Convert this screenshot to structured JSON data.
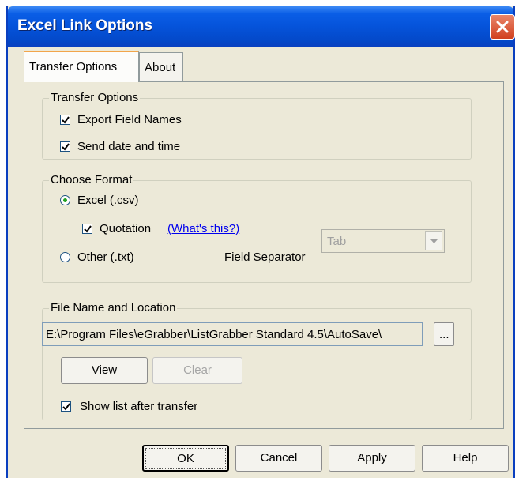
{
  "window": {
    "title": "Excel Link Options"
  },
  "tabs": [
    {
      "label": "Transfer Options",
      "active": true
    },
    {
      "label": "About",
      "active": false
    }
  ],
  "transfer_options": {
    "legend": "Transfer Options",
    "export_field_names": {
      "label": "Export Field Names",
      "checked": true
    },
    "send_date_time": {
      "label": "Send date and time",
      "checked": true
    }
  },
  "choose_format": {
    "legend": "Choose Format",
    "excel": {
      "label": "Excel  (.csv)",
      "selected": true
    },
    "quotation": {
      "label": "Quotation",
      "checked": true
    },
    "whats_this": "(What's this?)",
    "other": {
      "label": "Other  (.txt)",
      "selected": false
    },
    "field_separator": {
      "label": "Field Separator",
      "value": "Tab"
    }
  },
  "file_location": {
    "legend": "File Name and Location",
    "path": "E:\\Program Files\\eGrabber\\ListGrabber Standard 4.5\\AutoSave\\",
    "browse_label": "...",
    "view_label": "View",
    "clear_label": "Clear",
    "show_list": {
      "label": "Show list after transfer",
      "checked": true
    }
  },
  "footer": {
    "ok": "OK",
    "cancel": "Cancel",
    "apply": "Apply",
    "help": "Help"
  },
  "colors": {
    "title_bar": "#0553da",
    "face": "#ece9d8",
    "close": "#d1401f",
    "link": "#0000ee"
  },
  "icons": {
    "close": "close-icon",
    "check": "checkmark-icon",
    "dropdown": "chevron-down-icon"
  }
}
